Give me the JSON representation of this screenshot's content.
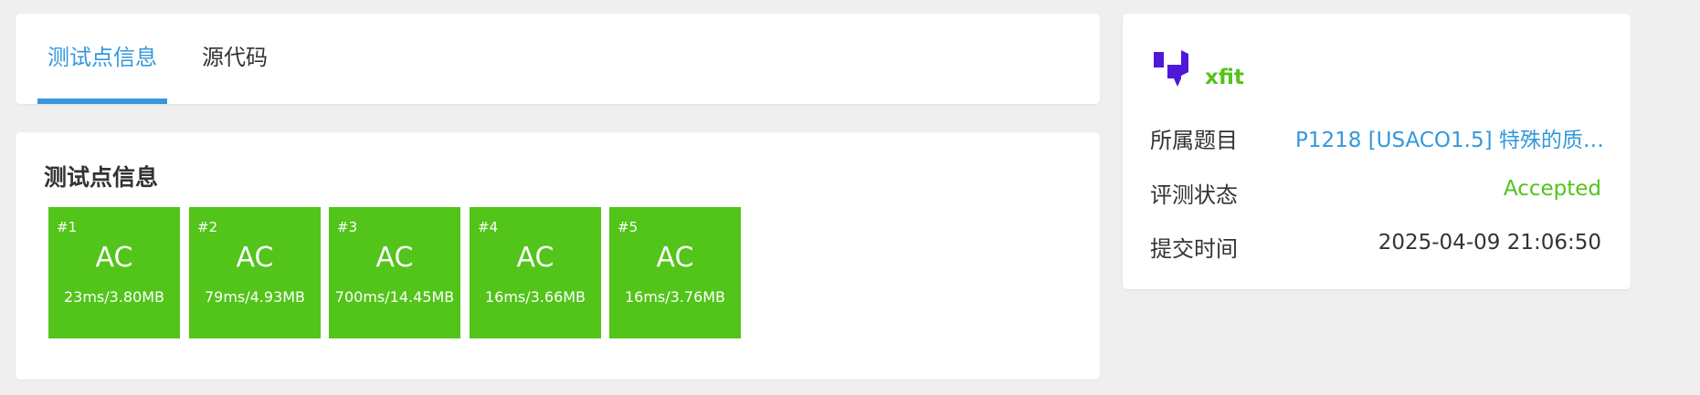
{
  "tabs": [
    {
      "label": "测试点信息",
      "active": true
    },
    {
      "label": "源代码",
      "active": false
    }
  ],
  "cases_section": {
    "title": "测试点信息",
    "cases": [
      {
        "num": "#1",
        "status": "AC",
        "stat": "23ms/3.80MB"
      },
      {
        "num": "#2",
        "status": "AC",
        "stat": "79ms/4.93MB"
      },
      {
        "num": "#3",
        "status": "AC",
        "stat": "700ms/14.45MB"
      },
      {
        "num": "#4",
        "status": "AC",
        "stat": "16ms/3.66MB"
      },
      {
        "num": "#5",
        "status": "AC",
        "stat": "16ms/3.76MB"
      }
    ]
  },
  "info": {
    "username": "xfit",
    "rows": [
      {
        "label": "所属题目",
        "value": "P1218 [USACO1.5] 特殊的质数..."
      },
      {
        "label": "评测状态",
        "value": "Accepted"
      },
      {
        "label": "提交时间",
        "value": "2025-04-09 21:06:50"
      }
    ]
  },
  "colors": {
    "accent": "#3498db",
    "accepted": "#52c41a",
    "logo": "#4f17d9",
    "background": "#efefef"
  },
  "icons": {
    "logo": "user-logo-icon"
  }
}
